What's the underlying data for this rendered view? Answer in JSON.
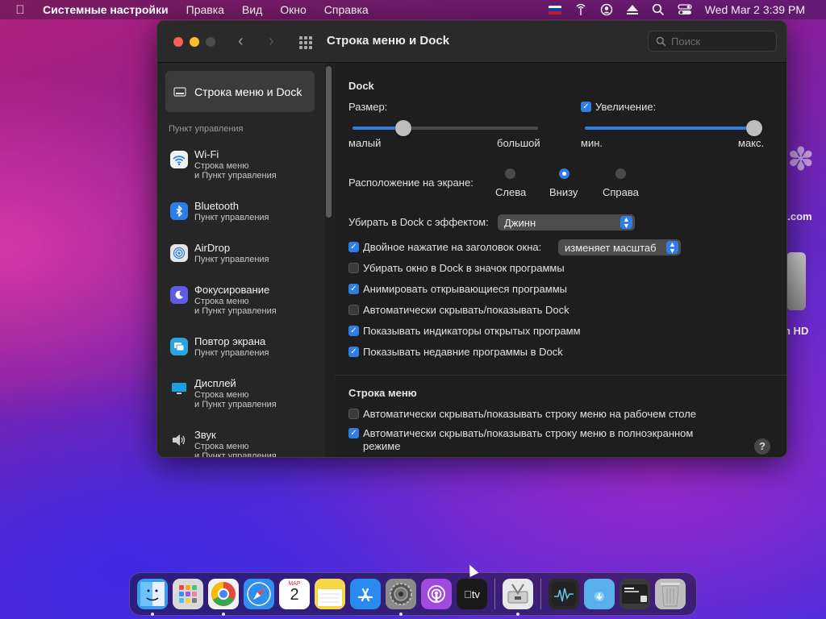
{
  "menubar": {
    "app_name": "Системные настройки",
    "items": [
      "Правка",
      "Вид",
      "Окно",
      "Справка"
    ],
    "clock": "Wed Mar 2  3:39 PM"
  },
  "window": {
    "title": "Строка меню и Dock",
    "search_placeholder": "Поиск"
  },
  "sidebar": {
    "selected": "Строка меню и Dock",
    "section_header": "Пункт управления",
    "items": [
      {
        "name": "Wi-Fi",
        "sub1": "Строка меню",
        "sub2": "и Пункт управления",
        "icon": "wifi-icon",
        "color": "#2a7fe8"
      },
      {
        "name": "Bluetooth",
        "sub1": "Пункт управления",
        "sub2": "",
        "icon": "bluetooth-icon",
        "color": "#2a7fe8"
      },
      {
        "name": "AirDrop",
        "sub1": "Пункт управления",
        "sub2": "",
        "icon": "airdrop-icon",
        "color": "#e6e6e6"
      },
      {
        "name": "Фокусирование",
        "sub1": "Строка меню",
        "sub2": "и Пункт управления",
        "icon": "moon-icon",
        "color": "#5e5ce6"
      },
      {
        "name": "Повтор экрана",
        "sub1": "Пункт управления",
        "sub2": "",
        "icon": "screen-mirroring-icon",
        "color": "#2aa5e0"
      },
      {
        "name": "Дисплей",
        "sub1": "Строка меню",
        "sub2": "и Пункт управления",
        "icon": "display-icon",
        "color": "#1aa0e0"
      },
      {
        "name": "Звук",
        "sub1": "Строка меню",
        "sub2": "и Пункт управления",
        "icon": "speaker-icon",
        "color": "#cfcfcf"
      }
    ]
  },
  "dock_section": {
    "header": "Dock",
    "size_label": "Размер:",
    "size_min": "малый",
    "size_max": "большой",
    "size_value": 0.25,
    "magnification_label": "Увеличение:",
    "magnification_checked": true,
    "mag_min": "мин.",
    "mag_max": "макс.",
    "mag_value": 1.0,
    "position_label": "Расположение на экране:",
    "position_options": [
      "Слева",
      "Внизу",
      "Справа"
    ],
    "position_selected": "Внизу",
    "minimize_label": "Убирать в Dock с эффектом:",
    "minimize_value": "Джинн",
    "double_click_label": "Двойное нажатие на заголовок окна:",
    "double_click_value": "изменяет масштаб",
    "checkboxes": [
      {
        "label": "Убирать окно в Dock в значок программы",
        "checked": false
      },
      {
        "label": "Анимировать открывающиеся программы",
        "checked": true
      },
      {
        "label": "Автоматически скрывать/показывать Dock",
        "checked": false
      },
      {
        "label": "Показывать индикаторы открытых программ",
        "checked": true
      },
      {
        "label": "Показывать недавние программы в Dock",
        "checked": true
      }
    ]
  },
  "menubar_section": {
    "header": "Строка меню",
    "checkboxes": [
      {
        "label": "Автоматически скрывать/показывать строку меню на рабочем столе",
        "checked": false
      },
      {
        "label": "Автоматически скрывать/показывать строку меню в полноэкранном",
        "label2": "режиме",
        "checked": true
      }
    ]
  },
  "help_label": "?",
  "desktop": {
    "label1": "а.com",
    "label2": "h HD"
  },
  "dock_apps": [
    {
      "name": "finder-icon",
      "color": "#3a9af0",
      "running": true
    },
    {
      "name": "launchpad-icon",
      "color": "#d9d9d9",
      "running": false
    },
    {
      "name": "chrome-icon",
      "color": "#f2f2f2",
      "running": true
    },
    {
      "name": "safari-icon",
      "color": "#2f8ef0",
      "running": false
    },
    {
      "name": "calendar-icon",
      "color": "#ffffff",
      "running": false,
      "month": "МАР",
      "day": "2"
    },
    {
      "name": "notes-icon",
      "color": "#f6d64a",
      "running": false
    },
    {
      "name": "app-store-icon",
      "color": "#2a8af0",
      "running": false
    },
    {
      "name": "system-preferences-icon",
      "color": "#8a8a8a",
      "running": true
    },
    {
      "name": "podcasts-icon",
      "color": "#a04ae0",
      "running": false
    },
    {
      "name": "apple-tv-icon",
      "color": "#1a1a1a",
      "running": false,
      "label": "tv"
    },
    {
      "name": "disk-utility-icon",
      "color": "#e8e8e8",
      "running": true
    },
    {
      "name": "activity-monitor-icon",
      "color": "#2a2a2a",
      "running": false
    },
    {
      "name": "downloads-folder-icon",
      "color": "#5ab0ea",
      "running": false
    },
    {
      "name": "recent-document-icon",
      "color": "#3a3a3a",
      "running": false
    },
    {
      "name": "trash-icon",
      "color": "#bdbdbd",
      "running": false
    }
  ]
}
